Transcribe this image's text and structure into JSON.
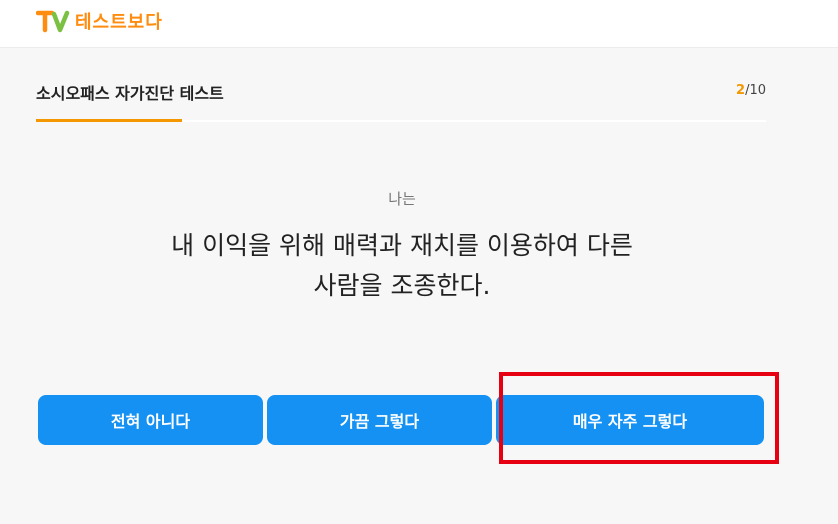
{
  "logo": {
    "text": "테스트보다",
    "icon": "tv-logo-icon",
    "colors": {
      "t": "#ff8c0e",
      "v": "#7bc043",
      "text": "#ff8c0e"
    }
  },
  "test": {
    "title": "소시오패스 자가진단 테스트",
    "progress": {
      "current": "2",
      "separator_total": "/10"
    },
    "progress_fraction": 0.2
  },
  "question": {
    "prefix": "나는",
    "line1": "내 이익을 위해 매력과 재치를 이용하여 다른",
    "line2": "사람을 조종한다."
  },
  "answers": [
    {
      "label": "전혀 아니다"
    },
    {
      "label": "가끔 그렇다"
    },
    {
      "label": "매우 자주 그렇다"
    }
  ],
  "colors": {
    "accent": "#f39800",
    "button": "#1591f3",
    "highlight": "#e60012"
  }
}
